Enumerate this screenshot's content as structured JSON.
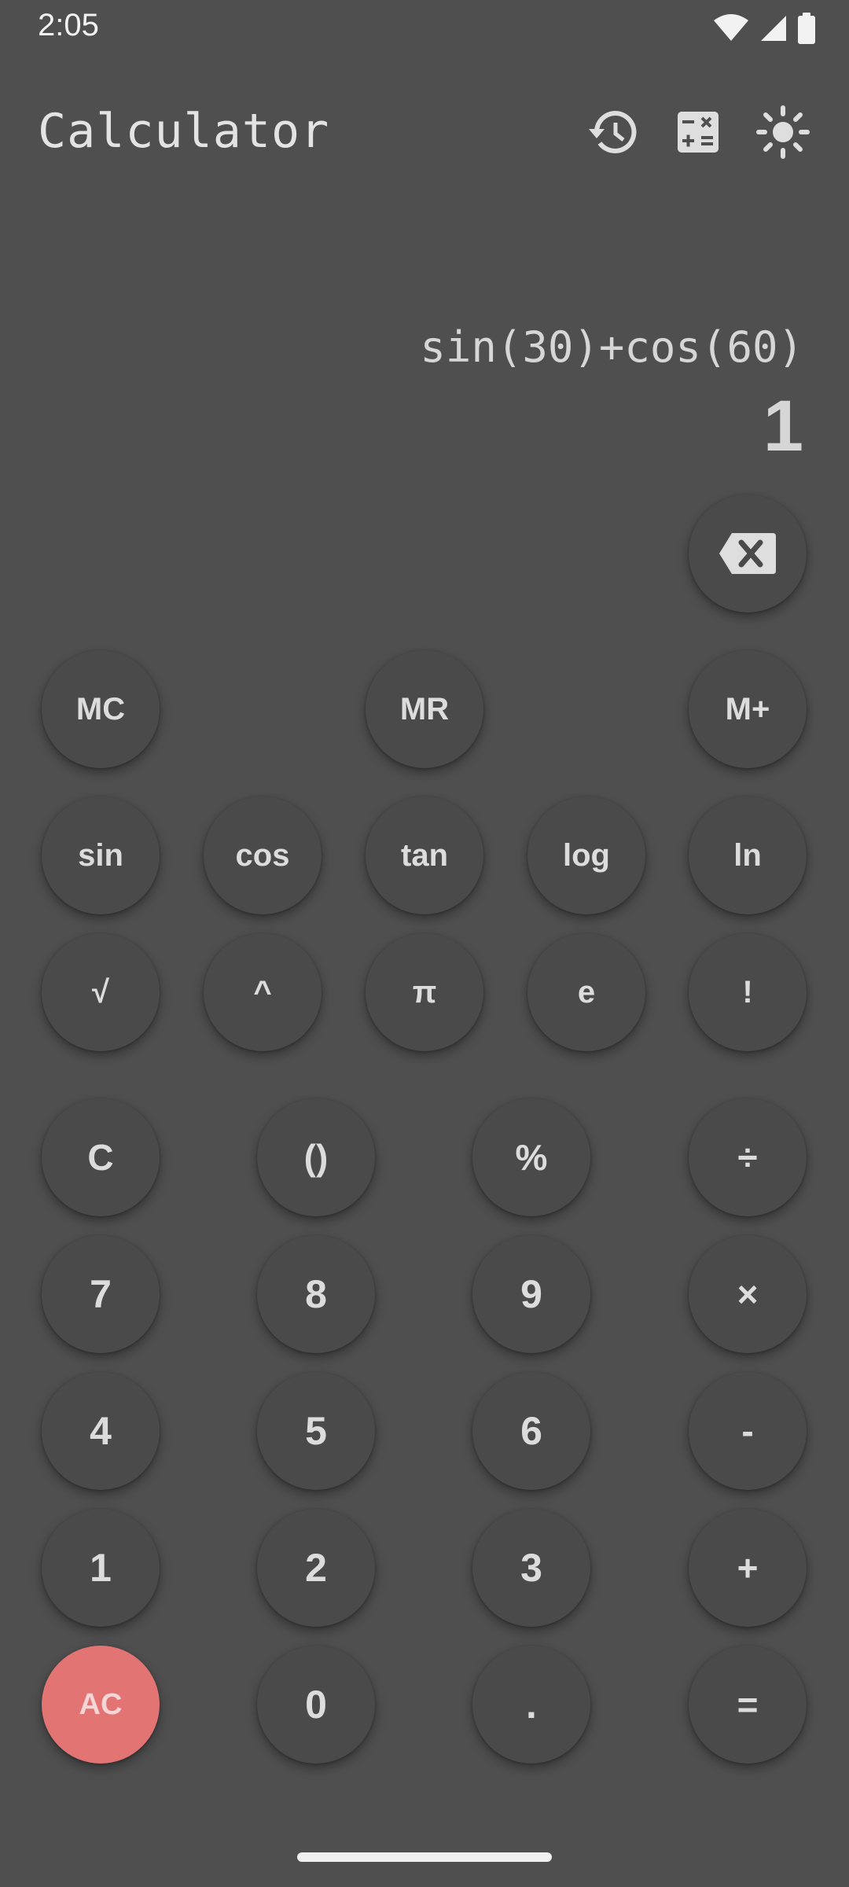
{
  "status_bar": {
    "time": "2:05",
    "icons": [
      "wifi-icon",
      "cell-signal-icon",
      "battery-icon"
    ]
  },
  "header": {
    "title": "Calculator",
    "actions": [
      "history-icon",
      "calculator-mode-icon",
      "theme-toggle-icon"
    ]
  },
  "display": {
    "expression": "sin(30)+cos(60)",
    "result": "1"
  },
  "keypad": {
    "memory": [
      "MC",
      "MR",
      "M+"
    ],
    "functions_row1": [
      "sin",
      "cos",
      "tan",
      "log",
      "ln"
    ],
    "functions_row2": [
      "√",
      "^",
      "π",
      "e",
      "!"
    ],
    "row_c": [
      "C",
      "()",
      "%",
      "÷"
    ],
    "row_7": [
      "7",
      "8",
      "9",
      "×"
    ],
    "row_4": [
      "4",
      "5",
      "6",
      "-"
    ],
    "row_1": [
      "1",
      "2",
      "3",
      "+"
    ],
    "row_0": [
      "AC",
      "0",
      ".",
      "="
    ]
  },
  "colors": {
    "background": "#4f4f4f",
    "button": "#4a4a4a",
    "button_text": "#dcdcdc",
    "clear_all_button": "#e27474"
  }
}
